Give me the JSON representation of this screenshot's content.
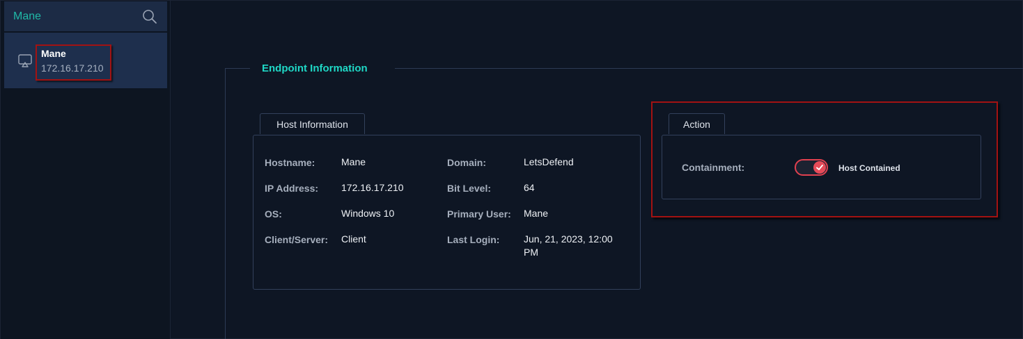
{
  "sidebar": {
    "search": {
      "value": "Mane",
      "icon": "search-icon"
    },
    "hosts": [
      {
        "name": "Mane",
        "ip": "172.16.17.210",
        "icon": "monitor-icon"
      }
    ]
  },
  "main": {
    "section_title": "Endpoint Information",
    "host_information": {
      "tab_label": "Host Information",
      "fields": [
        {
          "label": "Hostname:",
          "value": "Mane"
        },
        {
          "label": "IP Address:",
          "value": "172.16.17.210"
        },
        {
          "label": "OS:",
          "value": "Windows 10"
        },
        {
          "label": "Client/Server:",
          "value": "Client"
        },
        {
          "label": "Domain:",
          "value": "LetsDefend"
        },
        {
          "label": "Bit Level:",
          "value": "64"
        },
        {
          "label": "Primary User:",
          "value": "Mane"
        },
        {
          "label": "Last Login:",
          "value_line1": "Jun, 21, 2023, 12:00",
          "value_line2": "PM"
        }
      ]
    },
    "action": {
      "tab_label": "Action",
      "containment_label": "Containment:",
      "toggle_on": true,
      "toggle_text": "Host Contained"
    }
  },
  "colors": {
    "background": "#0e1624",
    "accent_teal": "#1fd8c6",
    "highlight_red": "#a31212",
    "toggle_red": "#e64b59"
  }
}
